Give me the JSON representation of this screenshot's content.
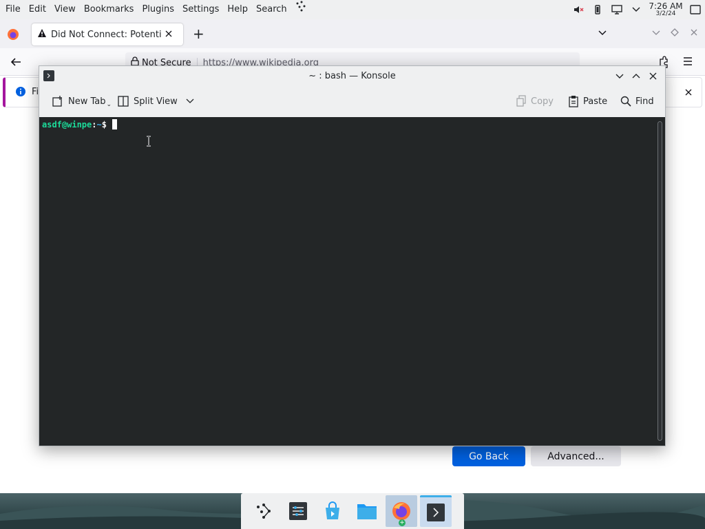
{
  "menubar": {
    "items": [
      "File",
      "Edit",
      "View",
      "Bookmarks",
      "Plugins",
      "Settings",
      "Help",
      "Search"
    ]
  },
  "clock": {
    "time": "7:26 AM",
    "date": "3/2/24"
  },
  "firefox": {
    "tab_title": "Did Not Connect: Potential Security Issue",
    "url_security": "Not Secure",
    "url": "https://www.wikipedia.org",
    "info_bar_text": "Fi",
    "go_back_label": "Go Back",
    "advanced_label": "Advanced..."
  },
  "konsole": {
    "title": "~ : bash — Konsole",
    "toolbar": {
      "new_tab": "New Tab",
      "split_view": "Split View",
      "copy": "Copy",
      "paste": "Paste",
      "find": "Find"
    },
    "prompt": {
      "user_host": "asdf@winpe",
      "colon": ":",
      "path": "~",
      "sign": "$"
    }
  },
  "colors": {
    "prompt_user": "#1cdc9a",
    "prompt_path": "#3daee9",
    "terminal_bg": "#232627",
    "accent": "#0061e0"
  },
  "dock": {
    "icons": [
      "kde-launcher-icon",
      "system-settings-icon",
      "discover-icon",
      "dolphin-icon",
      "firefox-icon",
      "konsole-icon"
    ]
  }
}
